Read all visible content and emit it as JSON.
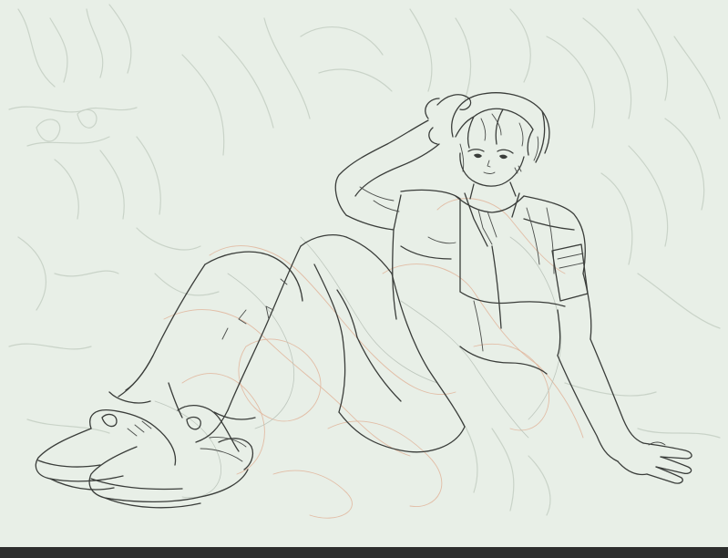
{
  "canvas": {
    "background": "#e8efe7",
    "subject": "line-art-sketch-seated-character"
  },
  "colors": {
    "lineart": "#3a3d3a",
    "background_sketch": "#c9d3c8",
    "rough_sketch": "#e0b49a",
    "bottom_bar": "#2d2e2d"
  }
}
